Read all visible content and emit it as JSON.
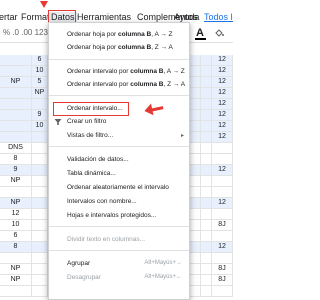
{
  "menubar": {
    "items": [
      "ertar",
      "Formato",
      "Datos",
      "Herramientas",
      "Complementos",
      "Ayuda"
    ],
    "last_edit": "Todos los"
  },
  "toolbar": {
    "left_text": "%  .0  .00  123",
    "font_color_letter": "A"
  },
  "grid": {
    "rows": [
      [
        "",
        "6",
        "",
        "",
        "12"
      ],
      [
        "",
        "10",
        "",
        "",
        "12"
      ],
      [
        "NP",
        "5",
        "",
        "",
        "12"
      ],
      [
        "",
        "NP",
        "",
        "",
        "12"
      ],
      [
        "",
        "",
        "",
        "",
        "12"
      ],
      [
        "",
        "9",
        "",
        "",
        "12"
      ],
      [
        "",
        "10",
        "",
        "",
        "12"
      ],
      [
        "",
        "",
        "",
        "",
        "12"
      ],
      [
        "DNS",
        "",
        "",
        "",
        ""
      ],
      [
        "8",
        "",
        "",
        "",
        ""
      ],
      [
        "9",
        "",
        "",
        "",
        "12"
      ],
      [
        "NP",
        "",
        "",
        "",
        ""
      ],
      [
        "",
        "",
        "",
        "",
        ""
      ],
      [
        "NP",
        "",
        "",
        "",
        "12"
      ],
      [
        "12",
        "",
        "",
        "",
        ""
      ],
      [
        "10",
        "",
        "",
        "",
        "8J"
      ],
      [
        "6",
        "",
        "",
        "",
        ""
      ],
      [
        "8",
        "",
        "",
        "",
        "12"
      ],
      [
        "",
        "",
        "",
        "",
        ""
      ],
      [
        "NP",
        "",
        "",
        "",
        "8J"
      ],
      [
        "NP",
        "",
        "",
        "",
        "8J"
      ],
      [
        "",
        "",
        "",
        "",
        ""
      ]
    ]
  },
  "dropdown": {
    "sort_sheet_az": {
      "prefix": "Ordenar hoja por ",
      "col": "columna B",
      "suffix": ", A → Z"
    },
    "sort_sheet_za": {
      "prefix": "Ordenar hoja por ",
      "col": "columna B",
      "suffix": ", Z → A"
    },
    "sort_range_az": {
      "prefix": "Ordenar intervalo por ",
      "col": "columna B",
      "suffix": ", A → Z"
    },
    "sort_range_za": {
      "prefix": "Ordenar intervalo por ",
      "col": "columna B",
      "suffix": ", Z → A"
    },
    "sort_range": "Ordenar intervalo...",
    "create_filter": "Crear un filtro",
    "filter_views": "Vistas de filtro...",
    "data_validation": "Validación de datos...",
    "pivot_table": "Tabla dinámica...",
    "randomize_range": "Ordenar aleatoriamente el intervalo",
    "named_ranges": "Intervalos con nombre...",
    "protected_ranges": "Hojas e intervalos protegidos...",
    "split_text": "Dividir texto en columnas...",
    "group": "Agrupar",
    "group_shortcut": "Alt+Mayús+→",
    "ungroup": "Desagrupar",
    "ungroup_shortcut": "Alt+Mayús+←"
  },
  "colors": {
    "accent_red": "#e53935",
    "selection_blue": "#e8f0fe",
    "link_blue": "#1a73e8"
  }
}
